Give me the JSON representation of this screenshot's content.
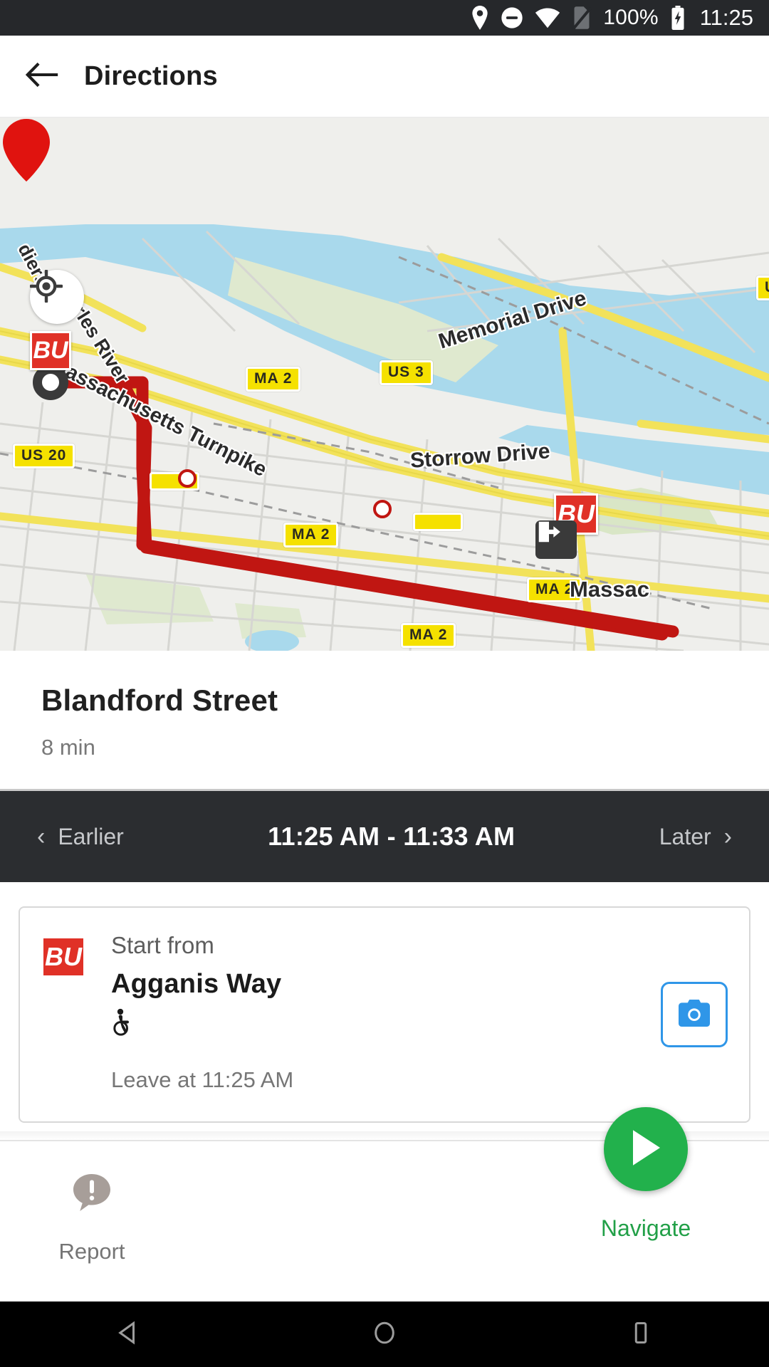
{
  "statusbar": {
    "icons": [
      "location-pin-icon",
      "do-not-disturb-icon",
      "wifi-icon",
      "no-sim-icon"
    ],
    "battery_percent": "100%",
    "battery_icon": "battery-charging-icon",
    "clock": "11:25"
  },
  "appbar": {
    "back_icon": "back-arrow-icon",
    "title": "Directions"
  },
  "map": {
    "locate_icon": "my-location-icon",
    "origin_badge": "BU",
    "destination_badge": "BU",
    "arrive_icon": "arrive-door-icon",
    "labels": [
      {
        "text": "Charles River"
      },
      {
        "text": "Memorial Drive"
      },
      {
        "text": "Massachusetts Turnpike"
      },
      {
        "text": "Storrow Drive"
      },
      {
        "text": "Massac"
      },
      {
        "text": "diers"
      }
    ],
    "shields": [
      {
        "text": "MA 2"
      },
      {
        "text": "US 3"
      },
      {
        "text": "US 20"
      },
      {
        "text": "MA 2"
      },
      {
        "text": "MA 2"
      },
      {
        "text": "MA 2"
      },
      {
        "text": "U"
      }
    ],
    "route_color": "#c01612"
  },
  "summary": {
    "title": "Blandford Street",
    "duration": "8 min"
  },
  "timebar": {
    "earlier_label": "Earlier",
    "earlier_icon": "chevron-left-icon",
    "range": "11:25 AM - 11:33 AM",
    "later_label": "Later",
    "later_icon": "chevron-right-icon"
  },
  "step_card": {
    "logo_text": "BU",
    "label": "Start from",
    "name": "Agganis Way",
    "accessibility_icon": "wheelchair-accessible-icon",
    "leave_at": "Leave at 11:25 AM",
    "camera_icon": "camera-icon",
    "camera_accent": "#2f96e8"
  },
  "actions": {
    "report_icon": "report-alert-icon",
    "report_label": "Report",
    "navigate_icon": "play-arrow-icon",
    "navigate_label": "Navigate",
    "navigate_color": "#22b14c"
  },
  "navbar": {
    "back_icon": "android-back-icon",
    "home_icon": "android-home-icon",
    "recents_icon": "android-recents-icon"
  }
}
